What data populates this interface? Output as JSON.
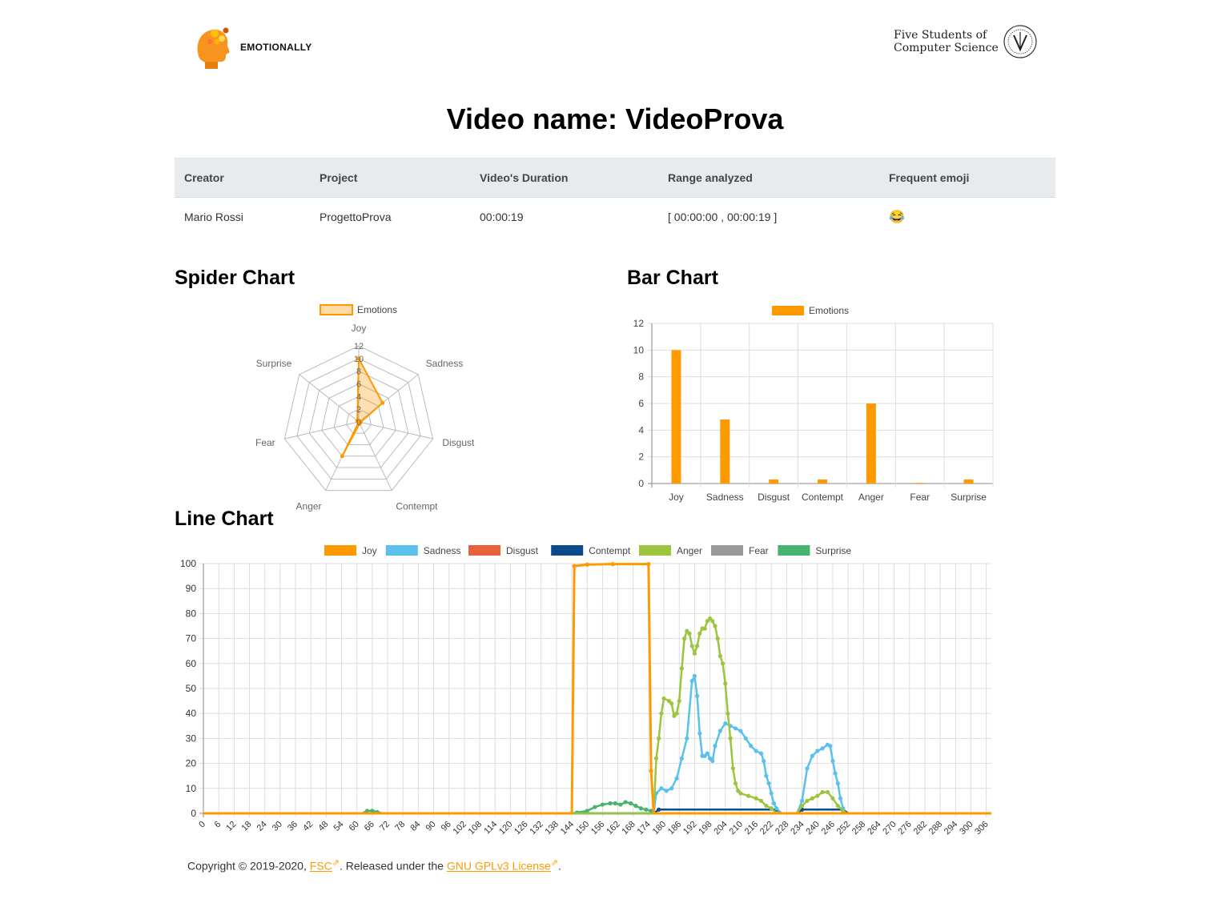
{
  "header": {
    "brand": "EMOTIONALLY",
    "org_line1": "Five Students of",
    "org_line2": "Computer Science"
  },
  "page_title": "Video name: VideoProva",
  "info_table": {
    "headers": [
      "Creator",
      "Project",
      "Video's Duration",
      "Range analyzed",
      "Frequent emoji"
    ],
    "row": [
      "Mario Rossi",
      "ProgettoProva",
      "00:00:19",
      "[ 00:00:00 , 00:00:19 ]",
      "😂"
    ]
  },
  "sections": {
    "spider": "Spider Chart",
    "bar": "Bar Chart",
    "line": "Line Chart"
  },
  "colors": {
    "accent": "#ff9900",
    "joy": "#ff9900",
    "sadness": "#5bc0eb",
    "disgust": "#e8603c",
    "contempt": "#0c4a8a",
    "anger": "#9bc53d",
    "fear": "#999999",
    "surprise": "#46b36e"
  },
  "chart_data": [
    {
      "type": "radar",
      "legend": [
        "Emotions"
      ],
      "categories": [
        "Joy",
        "Sadness",
        "Disgust",
        "Contempt",
        "Anger",
        "Fear",
        "Surprise"
      ],
      "values": [
        10,
        4.8,
        0.3,
        0.3,
        6,
        0,
        0.3
      ],
      "ticks": [
        "0",
        "2",
        "4",
        "6",
        "8",
        "10",
        "12"
      ],
      "rmax": 12
    },
    {
      "type": "bar",
      "legend": [
        "Emotions"
      ],
      "categories": [
        "Joy",
        "Sadness",
        "Disgust",
        "Contempt",
        "Anger",
        "Fear",
        "Surprise"
      ],
      "values": [
        10,
        4.8,
        0.3,
        0.3,
        6,
        0.05,
        0.3
      ],
      "ylim": [
        0,
        12
      ],
      "yticks": [
        "0",
        "2",
        "4",
        "6",
        "8",
        "10",
        "12"
      ]
    },
    {
      "type": "line",
      "legend": [
        "Joy",
        "Sadness",
        "Disgust",
        "Contempt",
        "Anger",
        "Fear",
        "Surprise"
      ],
      "xlim": [
        0,
        308
      ],
      "ylim": [
        0,
        100
      ],
      "yticks": [
        "0",
        "10",
        "20",
        "30",
        "40",
        "50",
        "60",
        "70",
        "80",
        "90",
        "100"
      ],
      "xticks": [
        "0",
        "6",
        "12",
        "18",
        "24",
        "30",
        "36",
        "42",
        "48",
        "54",
        "60",
        "66",
        "72",
        "78",
        "84",
        "90",
        "96",
        "102",
        "108",
        "114",
        "120",
        "126",
        "132",
        "138",
        "144",
        "150",
        "156",
        "162",
        "168",
        "174",
        "180",
        "186",
        "192",
        "198",
        "204",
        "210",
        "216",
        "222",
        "228",
        "234",
        "240",
        "246",
        "252",
        "258",
        "264",
        "270",
        "276",
        "282",
        "288",
        "294",
        "300",
        "306"
      ],
      "series": [
        {
          "name": "Joy",
          "points": [
            [
              0,
              0
            ],
            [
              144,
              0
            ],
            [
              145,
              99
            ],
            [
              150,
              99.6
            ],
            [
              160,
              99.8
            ],
            [
              174,
              99.8
            ],
            [
              175,
              17
            ],
            [
              176,
              0
            ],
            [
              308,
              0
            ]
          ]
        },
        {
          "name": "Sadness",
          "points": [
            [
              0,
              0
            ],
            [
              176,
              0
            ],
            [
              177,
              8
            ],
            [
              179,
              10
            ],
            [
              181,
              9
            ],
            [
              183,
              10
            ],
            [
              185,
              14
            ],
            [
              187,
              22
            ],
            [
              189,
              30
            ],
            [
              191,
              53
            ],
            [
              192,
              55
            ],
            [
              193,
              47
            ],
            [
              194,
              32
            ],
            [
              195,
              23
            ],
            [
              196,
              23
            ],
            [
              197,
              24
            ],
            [
              198,
              22
            ],
            [
              199,
              21
            ],
            [
              200,
              27
            ],
            [
              202,
              33
            ],
            [
              204,
              36
            ],
            [
              206,
              35
            ],
            [
              208,
              34
            ],
            [
              210,
              33
            ],
            [
              212,
              30
            ],
            [
              214,
              27
            ],
            [
              216,
              25
            ],
            [
              218,
              24
            ],
            [
              219,
              21
            ],
            [
              220,
              15
            ],
            [
              221,
              12
            ],
            [
              222,
              8
            ],
            [
              223,
              4
            ],
            [
              224,
              2
            ],
            [
              226,
              0
            ],
            [
              232,
              0
            ],
            [
              234,
              5
            ],
            [
              236,
              18
            ],
            [
              238,
              23
            ],
            [
              240,
              25
            ],
            [
              242,
              26
            ],
            [
              244,
              27.5
            ],
            [
              245,
              27
            ],
            [
              246,
              21
            ],
            [
              247,
              16
            ],
            [
              248,
              12
            ],
            [
              249,
              6
            ],
            [
              250,
              2
            ],
            [
              251,
              0
            ],
            [
              308,
              0
            ]
          ]
        },
        {
          "name": "Disgust",
          "points": [
            [
              0,
              0
            ],
            [
              308,
              0
            ]
          ]
        },
        {
          "name": "Contempt",
          "points": [
            [
              0,
              0
            ],
            [
              176,
              0
            ],
            [
              178,
              1.5
            ],
            [
              224,
              1.5
            ],
            [
              226,
              0
            ],
            [
              232,
              0
            ],
            [
              234,
              1.5
            ],
            [
              250,
              1.5
            ],
            [
              252,
              0
            ],
            [
              308,
              0
            ]
          ]
        },
        {
          "name": "Anger",
          "points": [
            [
              0,
              0
            ],
            [
              176,
              0
            ],
            [
              177,
              22
            ],
            [
              178,
              30
            ],
            [
              179,
              40
            ],
            [
              180,
              46
            ],
            [
              182,
              45
            ],
            [
              183,
              44
            ],
            [
              184,
              39
            ],
            [
              185,
              40
            ],
            [
              186,
              45
            ],
            [
              187,
              58
            ],
            [
              188,
              70
            ],
            [
              189,
              73
            ],
            [
              190,
              72
            ],
            [
              191,
              67
            ],
            [
              192,
              64
            ],
            [
              193,
              67
            ],
            [
              194,
              72
            ],
            [
              195,
              74
            ],
            [
              196,
              74
            ],
            [
              197,
              77
            ],
            [
              198,
              78
            ],
            [
              199,
              77
            ],
            [
              200,
              75
            ],
            [
              201,
              70
            ],
            [
              202,
              63
            ],
            [
              203,
              60
            ],
            [
              204,
              52
            ],
            [
              205,
              40
            ],
            [
              206,
              30
            ],
            [
              207,
              18
            ],
            [
              208,
              12
            ],
            [
              209,
              9
            ],
            [
              210,
              8
            ],
            [
              213,
              7
            ],
            [
              216,
              6
            ],
            [
              218,
              5
            ],
            [
              220,
              3
            ],
            [
              222,
              2
            ],
            [
              224,
              0
            ],
            [
              232,
              0
            ],
            [
              234,
              3
            ],
            [
              236,
              5
            ],
            [
              238,
              6
            ],
            [
              240,
              7
            ],
            [
              242,
              8.5
            ],
            [
              244,
              8.5
            ],
            [
              246,
              6
            ],
            [
              248,
              3
            ],
            [
              250,
              1
            ],
            [
              251,
              0
            ],
            [
              308,
              0
            ]
          ]
        },
        {
          "name": "Fear",
          "points": [
            [
              0,
              0
            ],
            [
              308,
              0
            ]
          ]
        },
        {
          "name": "Surprise",
          "points": [
            [
              0,
              0
            ],
            [
              62,
              0
            ],
            [
              64,
              1
            ],
            [
              66,
              1
            ],
            [
              68,
              0.5
            ],
            [
              70,
              0
            ],
            [
              144,
              0
            ],
            [
              146,
              0.3
            ],
            [
              150,
              1
            ],
            [
              153,
              2.5
            ],
            [
              156,
              3.5
            ],
            [
              159,
              4
            ],
            [
              161,
              4
            ],
            [
              163,
              3.5
            ],
            [
              165,
              4.5
            ],
            [
              167,
              4
            ],
            [
              169,
              3
            ],
            [
              171,
              2
            ],
            [
              173,
              1.5
            ],
            [
              175,
              1
            ],
            [
              177,
              0
            ],
            [
              308,
              0
            ]
          ]
        }
      ]
    }
  ],
  "footer": {
    "prefix": "Copyright © 2019-2020, ",
    "link1": "FSC",
    "middle": ". Released under the ",
    "link2": "GNU GPLv3 License",
    "suffix": "."
  }
}
